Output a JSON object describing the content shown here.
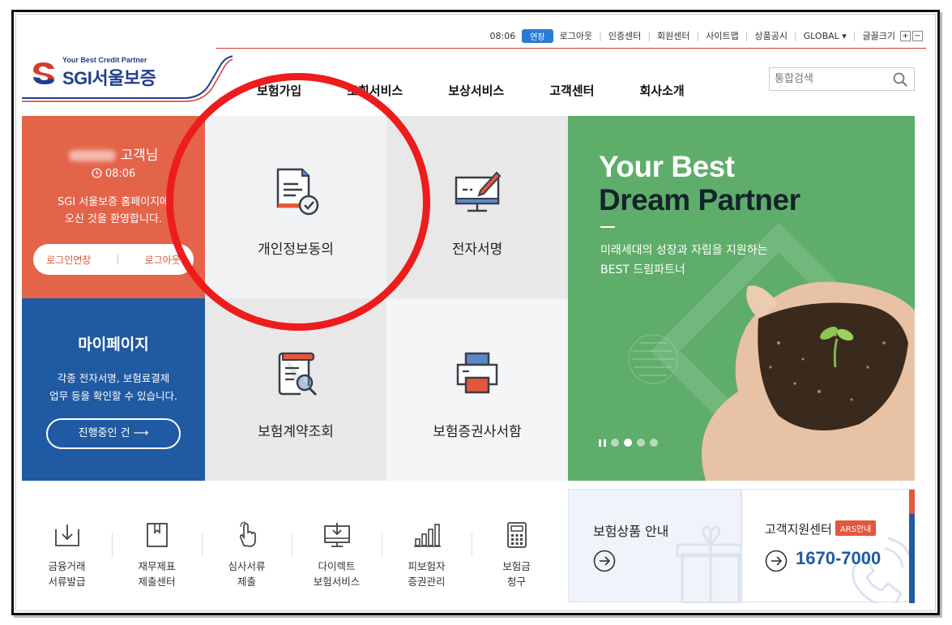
{
  "util": {
    "time": "08:06",
    "extend_label": "연장",
    "links": [
      "로그아웃",
      "인증센터",
      "회원센터",
      "사이트맵",
      "상품공시",
      "GLOBAL ▾",
      "글꼴크기"
    ],
    "font_plus": "+",
    "font_minus": "−"
  },
  "logo": {
    "tagline": "Your Best Credit Partner",
    "name": "SGI서울보증"
  },
  "gnb": [
    "보험가입",
    "조회서비스",
    "보상서비스",
    "고객센터",
    "회사소개"
  ],
  "search": {
    "placeholder": "통합검색"
  },
  "welcome": {
    "name_suffix": "고객님",
    "time": "08:06",
    "message_line1": "SGI 서울보증 홈페이지에",
    "message_line2": "오신 것을 환영합니다.",
    "extend_button": "로그인연장",
    "logout_button": "로그아웃"
  },
  "mypage": {
    "title": "마이페이지",
    "desc_line1": "각종 전자서명, 보험료결제",
    "desc_line2": "업무 등을 확인할 수 있습니다.",
    "button": "진행중인 건 ⟶"
  },
  "services": [
    {
      "label": "개인정보동의",
      "icon": "document-check-icon"
    },
    {
      "label": "전자서명",
      "icon": "monitor-pen-icon"
    },
    {
      "label": "보험계약조회",
      "icon": "scroll-search-icon"
    },
    {
      "label": "보험증권사서함",
      "icon": "printer-icon"
    }
  ],
  "banner": {
    "line1": "Your Best",
    "line2": "Dream Partner",
    "sub1": "미래세대의 성장과 자립을 지원하는",
    "sub2": "BEST 드림파트너",
    "slide_count": 4,
    "active_slide": 2
  },
  "quick": [
    {
      "l1": "금융거래",
      "l2": "서류발급",
      "icon": "download-tray-icon"
    },
    {
      "l1": "재무제표",
      "l2": "제출센터",
      "icon": "bookmark-doc-icon"
    },
    {
      "l1": "심사서류",
      "l2": "제출",
      "icon": "hand-pointer-icon"
    },
    {
      "l1": "다이렉트",
      "l2": "보험서비스",
      "icon": "monitor-download-icon"
    },
    {
      "l1": "피보험자",
      "l2": "증권관리",
      "icon": "bar-chart-icon"
    },
    {
      "l1": "보험금",
      "l2": "청구",
      "icon": "calculator-icon"
    }
  ],
  "cards": {
    "product_title": "보험상품 안내",
    "support_title": "고객지원센터",
    "ars_badge": "ARS안내",
    "phone": "1670-7000"
  },
  "colors": {
    "brand_blue": "#1f3f8b",
    "welcome_orange": "#e4644a",
    "mypage_blue": "#1f5aa3",
    "banner_green": "#5fad6a",
    "annotation_red": "#ee1c1c"
  }
}
